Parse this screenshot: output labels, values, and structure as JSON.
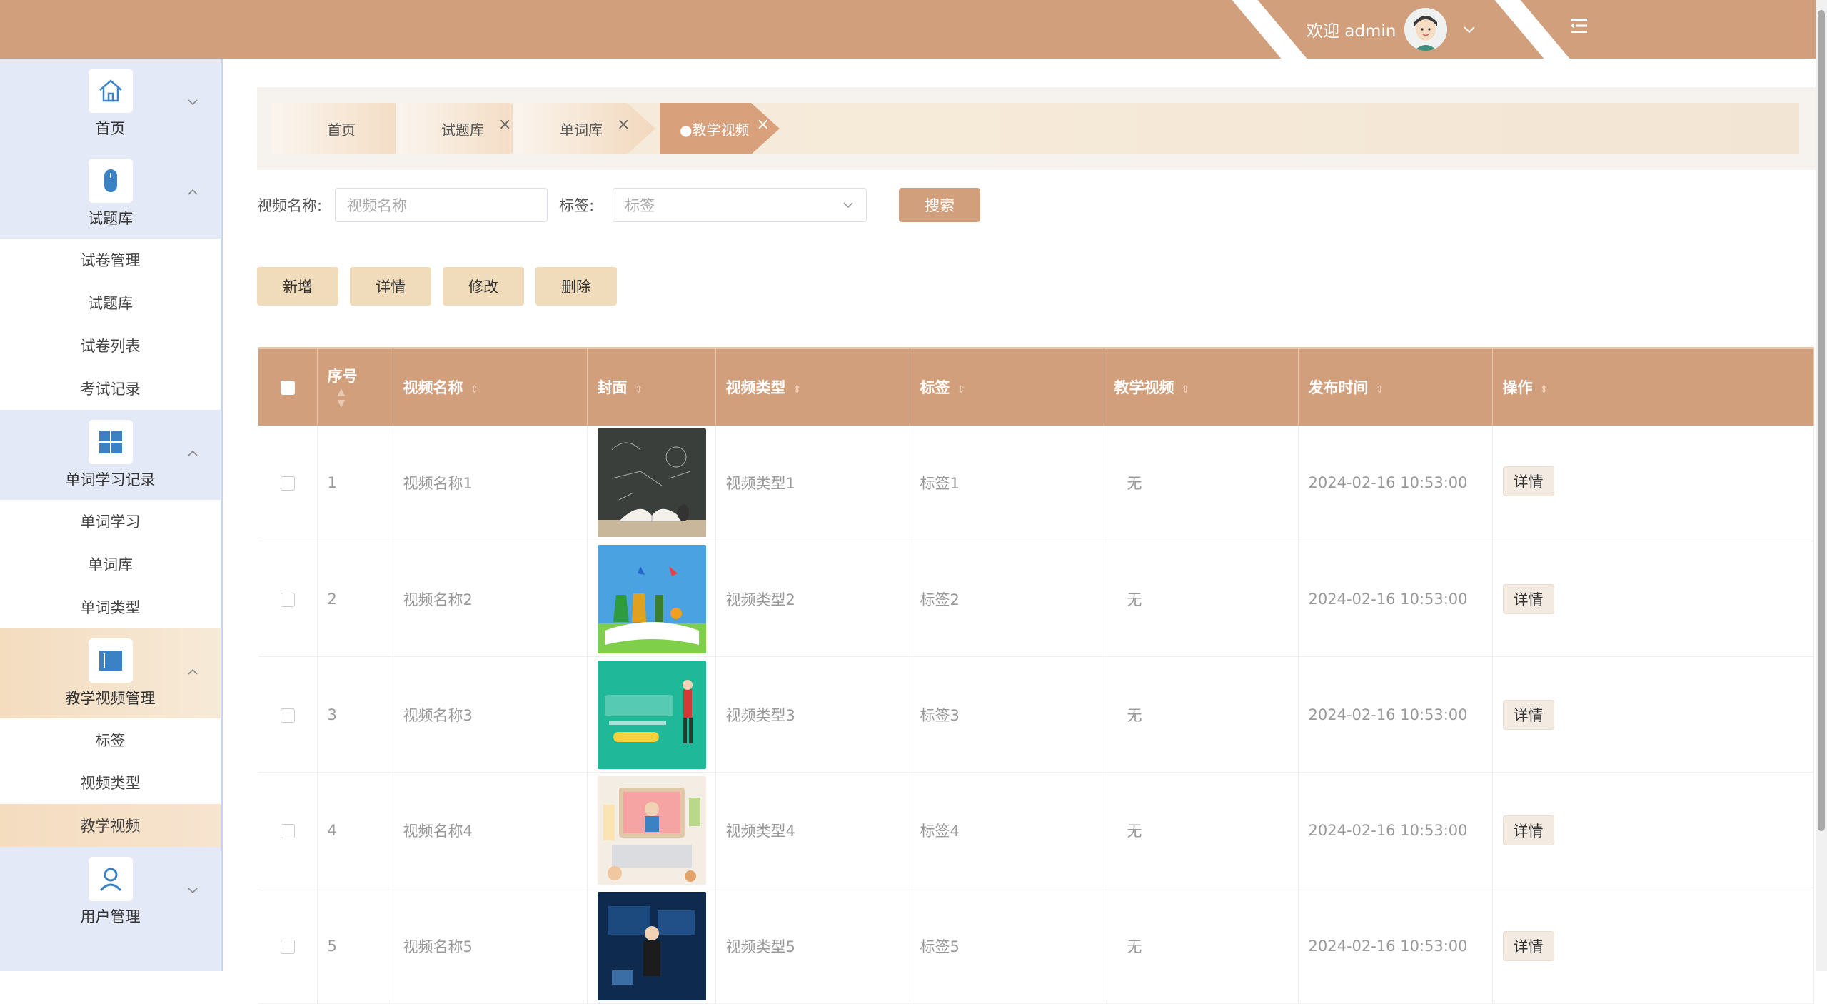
{
  "header": {
    "welcome_text": "欢迎 admin",
    "colors": {
      "bar": "#d29f7d"
    }
  },
  "sidebar": {
    "groups": [
      {
        "label": "首页",
        "icon": "home-icon",
        "expanded": false,
        "items": []
      },
      {
        "label": "试题库",
        "icon": "mouse-icon",
        "expanded": true,
        "items": [
          "试卷管理",
          "试题库",
          "试卷列表",
          "考试记录"
        ]
      },
      {
        "label": "单词学习记录",
        "icon": "grid-icon",
        "expanded": true,
        "items": [
          "单词学习",
          "单词库",
          "单词类型"
        ]
      },
      {
        "label": "教学视频管理",
        "icon": "book-icon",
        "expanded": true,
        "active": true,
        "items": [
          "标签",
          "视频类型",
          "教学视频"
        ],
        "selected_item": "教学视频"
      },
      {
        "label": "用户管理",
        "icon": "user-icon",
        "expanded": false,
        "items": []
      }
    ]
  },
  "breadcrumb": {
    "tabs": [
      {
        "label": "首页",
        "closable": false
      },
      {
        "label": "试题库",
        "closable": true
      },
      {
        "label": "单词库",
        "closable": true
      },
      {
        "label": "●教学视频",
        "closable": true,
        "active": true
      }
    ],
    "close_glyph": "×"
  },
  "search": {
    "name_label": "视频名称:",
    "name_placeholder": "视频名称",
    "tag_label": "标签:",
    "tag_placeholder": "标签",
    "button": "搜索"
  },
  "actions": [
    "新增",
    "详情",
    "修改",
    "删除"
  ],
  "table": {
    "columns": [
      "序号",
      "视频名称",
      "封面",
      "视频类型",
      "标签",
      "教学视频",
      "发布时间",
      "操作"
    ],
    "rows": [
      {
        "index": "1",
        "name": "视频名称1",
        "type": "视频类型1",
        "tag": "标签1",
        "video": "无",
        "time": "2024-02-16 10:53:00",
        "action": "详情"
      },
      {
        "index": "2",
        "name": "视频名称2",
        "type": "视频类型2",
        "tag": "标签2",
        "video": "无",
        "time": "2024-02-16 10:53:00",
        "action": "详情"
      },
      {
        "index": "3",
        "name": "视频名称3",
        "type": "视频类型3",
        "tag": "标签3",
        "video": "无",
        "time": "2024-02-16 10:53:00",
        "action": "详情"
      },
      {
        "index": "4",
        "name": "视频名称4",
        "type": "视频类型4",
        "tag": "标签4",
        "video": "无",
        "time": "2024-02-16 10:53:00",
        "action": "详情"
      },
      {
        "index": "5",
        "name": "视频名称5",
        "type": "视频类型5",
        "tag": "标签5",
        "video": "无",
        "time": "2024-02-16 10:53:00",
        "action": "详情"
      }
    ]
  }
}
